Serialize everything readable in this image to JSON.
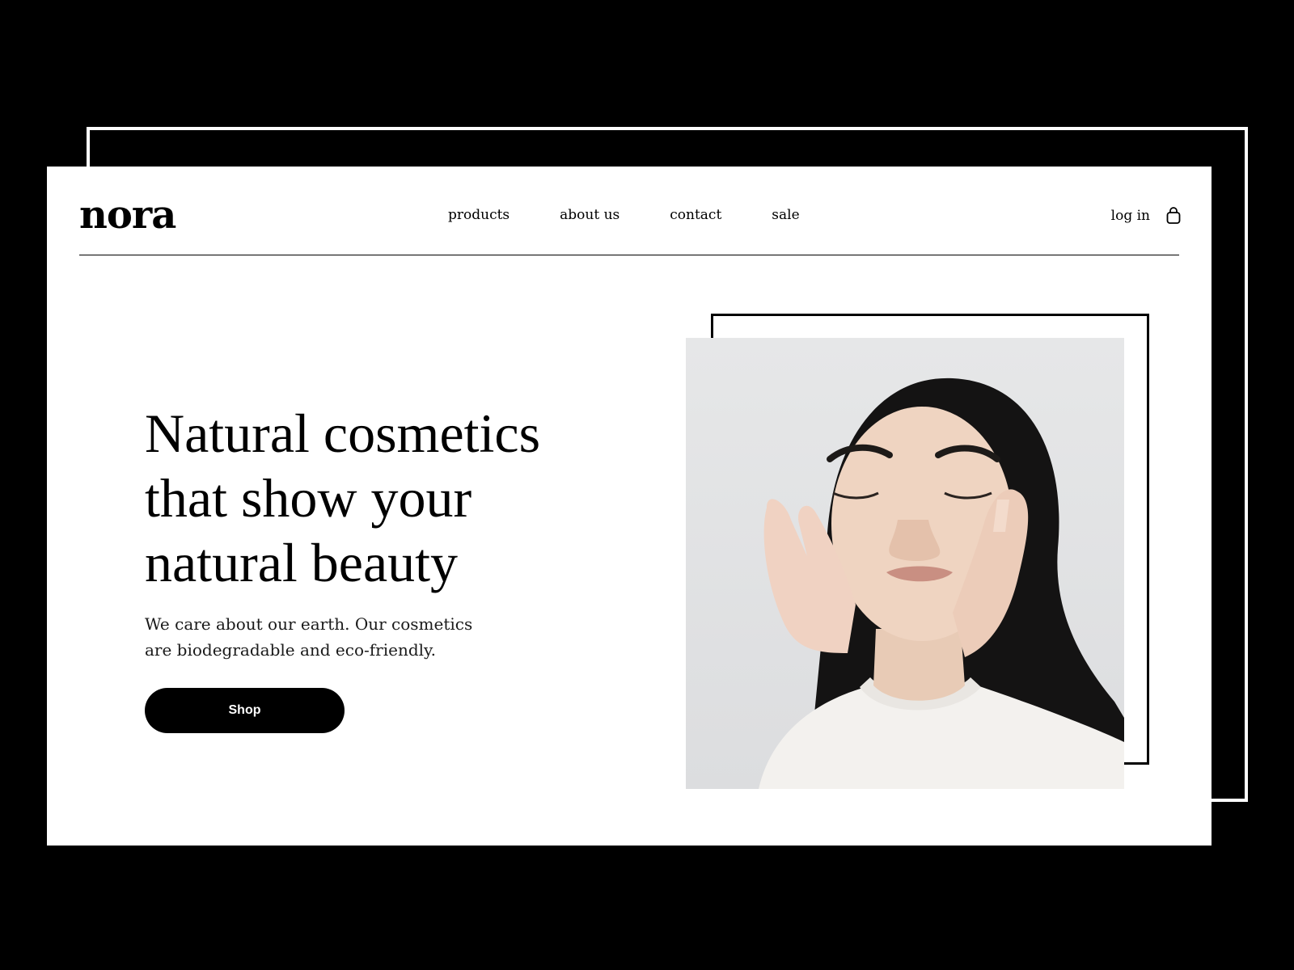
{
  "brand": {
    "logo_text": "nora"
  },
  "nav": {
    "items": [
      {
        "label": "products"
      },
      {
        "label": "about us"
      },
      {
        "label": "contact"
      },
      {
        "label": "sale"
      }
    ]
  },
  "header": {
    "login_label": "log in",
    "cart_icon": "shopping-bag-icon"
  },
  "hero": {
    "title": "Natural cosmetics that show your natural beauty",
    "text": "We care about our earth. Our cosmetics are biodegradable and eco-friendly.",
    "button_label": "Shop"
  },
  "colors": {
    "background": "#000000",
    "page": "#ffffff",
    "accent": "#000000",
    "photo_bg": "#e5e6e7"
  }
}
